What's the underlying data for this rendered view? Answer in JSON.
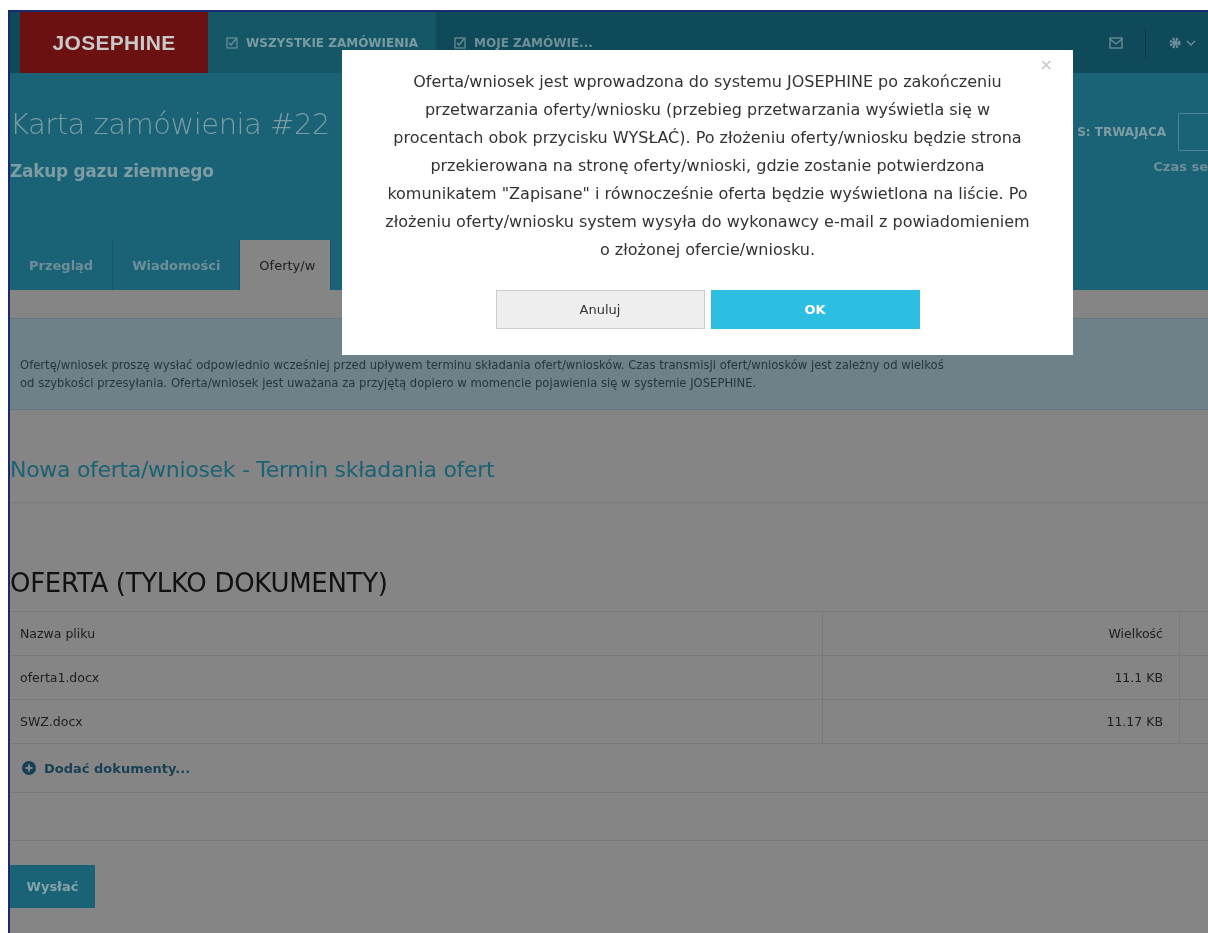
{
  "navbar": {
    "logo": "JOSEPHINE",
    "items": [
      {
        "label": "WSZYSTKIE ZAMÓWIENIA",
        "selected": true
      },
      {
        "label": "MOJE ZAMÓWIE...",
        "selected": false
      }
    ]
  },
  "header": {
    "title": "Karta zamówienia #22",
    "subtitle": "Zakup gazu ziemnego",
    "status": "S: TRWAJĄCA",
    "session_label": "Czas se"
  },
  "tabs": [
    {
      "label": "Przegląd",
      "selected": false
    },
    {
      "label": "Wiadomości",
      "selected": false
    },
    {
      "label": "Oferty/w",
      "selected": true
    }
  ],
  "info": [
    "Ofertę/wniosek proszę wysłać odpowiednio wcześniej przed upływem terminu składania ofert/wniosków. Czas transmisji ofert/wniosków jest zależny od wielkoś",
    "od szybkości przesyłania. Oferta/wniosek jest uważana za przyjętą dopiero w momencie pojawienia się w systemie JOSEPHINE."
  ],
  "section_title": "Nowa oferta/wniosek - Termin składania ofert",
  "offer_heading": "OFERTA (TYLKO DOKUMENTY)",
  "table": {
    "columns": [
      "Nazwa pliku",
      "Wielkość"
    ],
    "rows": [
      {
        "name": "oferta1.docx",
        "size": "11.1 KB"
      },
      {
        "name": "SWZ.docx",
        "size": "11.17 KB"
      }
    ]
  },
  "add_link": "Dodać dokumenty...",
  "send_button": "Wysłać",
  "dialog": {
    "message": "Oferta/wniosek jest wprowadzona do systemu JOSEPHINE po zakończeniu przetwarzania oferty/wniosku (przebieg przetwarzania wyświetla się w procentach obok przycisku WYSŁAĆ). Po złożeniu oferty/wniosku będzie strona przekierowana na stronę oferty/wnioski, gdzie zostanie potwierdzona komunikatem \"Zapisane\" i równocześnie oferta będzie wyświetlona na liście. Po złożeniu oferty/wniosku system wysyła do wykonawcy e-mail z powiadomieniem o złożonej ofercie/wniosku.",
    "close": "×",
    "buttons": [
      {
        "label": "Anuluj",
        "kind": "secondary"
      },
      {
        "label": "OK",
        "kind": "primary"
      }
    ]
  }
}
